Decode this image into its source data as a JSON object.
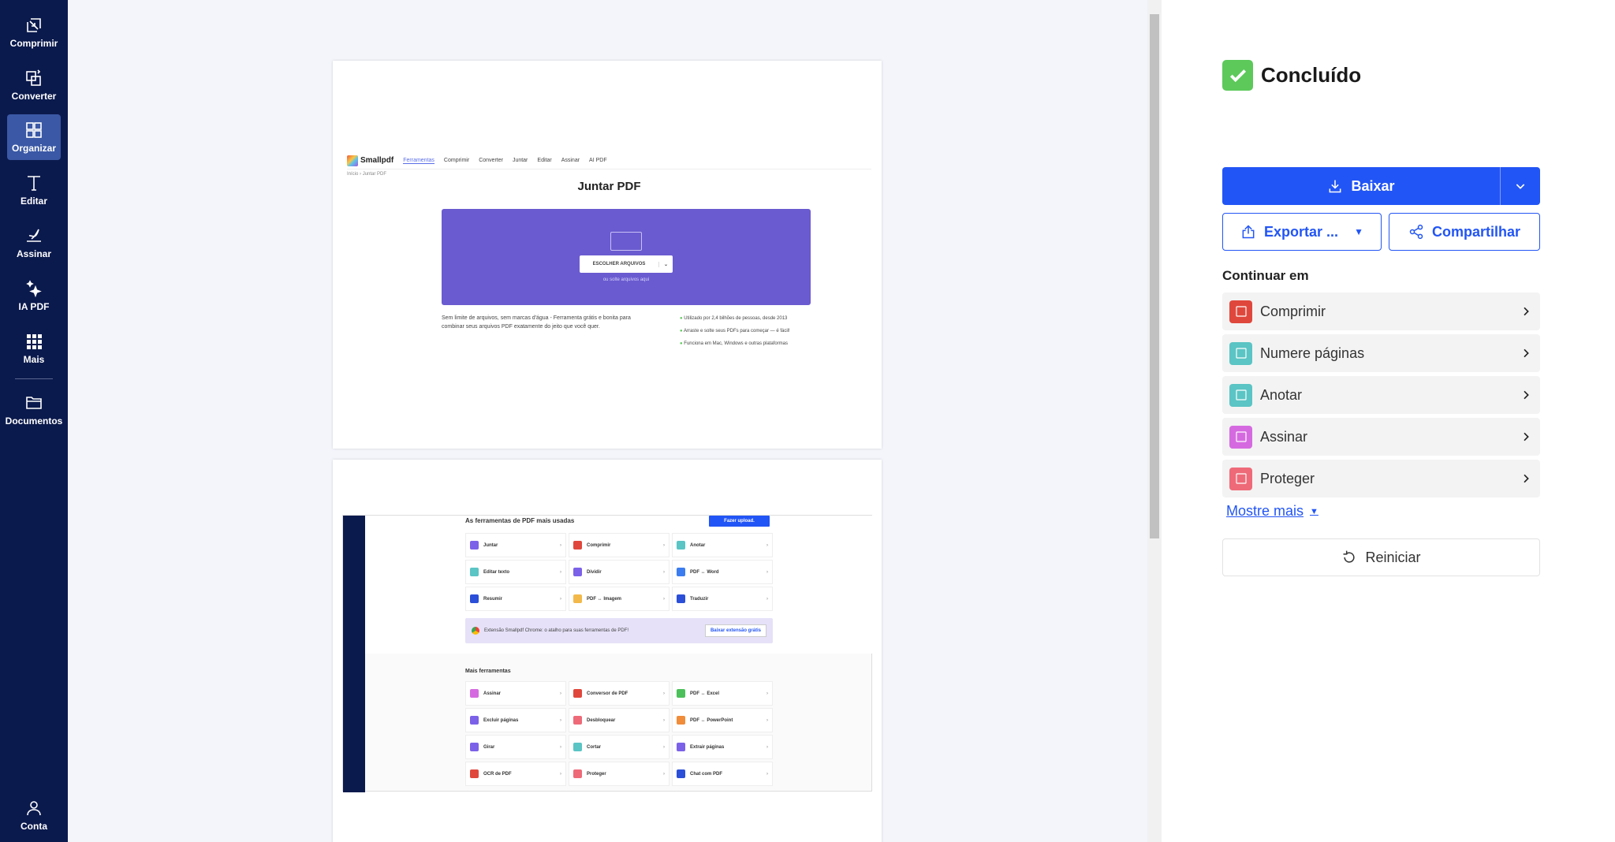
{
  "sidebar": {
    "items": [
      {
        "label": "Comprimir",
        "icon": "compress-icon"
      },
      {
        "label": "Converter",
        "icon": "convert-icon"
      },
      {
        "label": "Organizar",
        "icon": "grid-icon",
        "active": true
      },
      {
        "label": "Editar",
        "icon": "text-icon"
      },
      {
        "label": "Assinar",
        "icon": "signature-icon"
      },
      {
        "label": "IA PDF",
        "icon": "sparkles-icon"
      },
      {
        "label": "Mais",
        "icon": "apps-icon"
      }
    ],
    "documents": "Documentos",
    "account": "Conta"
  },
  "preview": {
    "page1": {
      "logo": "Smallpdf",
      "nav": [
        "Ferramentas",
        "Comprimir",
        "Converter",
        "Juntar",
        "Editar",
        "Assinar",
        "AI PDF"
      ],
      "breadcrumb": [
        "Início",
        "Juntar PDF"
      ],
      "title": "Juntar PDF",
      "choose": "ESCOLHER ARQUIVOS",
      "drop": "ou solte arquivos aqui",
      "desc": "Sem limite de arquivos, sem marcas d'água - Ferramenta grátis e bonita para combinar seus arquivos PDF exatamente do jeito que você quer.",
      "bullets": [
        "Utilizado por 2,4 bilhões de pessoas, desde 2013",
        "Arraste e solte seus PDFs para começar — é fácil!",
        "Funciona em Mac, Windows e outras plataformas"
      ]
    },
    "page2": {
      "heading": "As ferramentas de PDF mais usadas",
      "upload": "Fazer upload.",
      "tools": [
        {
          "l": "Juntar",
          "c": "#7b61e8"
        },
        {
          "l": "Comprimir",
          "c": "#e0473c"
        },
        {
          "l": "Anotar",
          "c": "#5bc4c4"
        },
        {
          "l": "Editar texto",
          "c": "#5bc4c4"
        },
        {
          "l": "Dividir",
          "c": "#7b61e8"
        },
        {
          "l": "PDF ↔ Word",
          "c": "#3b7cf0"
        },
        {
          "l": "Resumir",
          "c": "#2b4fd8"
        },
        {
          "l": "PDF ↔ Imagem",
          "c": "#f2b94a"
        },
        {
          "l": "Traduzir",
          "c": "#2b4fd8"
        }
      ],
      "ext_text": "Extensão Smallpdf Chrome: o atalho para suas ferramentas de PDF!",
      "ext_btn": "Baixar extensão grátis",
      "more_heading": "Mais ferramentas",
      "more_tools": [
        {
          "l": "Assinar",
          "c": "#d56ae0"
        },
        {
          "l": "Conversor de PDF",
          "c": "#e0473c"
        },
        {
          "l": "PDF ↔ Excel",
          "c": "#4cc05a"
        },
        {
          "l": "Excluir páginas",
          "c": "#7b61e8"
        },
        {
          "l": "Desbloquear",
          "c": "#ee6a78"
        },
        {
          "l": "PDF ↔ PowerPoint",
          "c": "#f08c3a"
        },
        {
          "l": "Girar",
          "c": "#7b61e8"
        },
        {
          "l": "Cortar",
          "c": "#5bc4c4"
        },
        {
          "l": "Extrair páginas",
          "c": "#7b61e8"
        },
        {
          "l": "OCR de PDF",
          "c": "#e0473c"
        },
        {
          "l": "Proteger",
          "c": "#ee6a78"
        },
        {
          "l": "Chat com PDF",
          "c": "#2b4fd8"
        }
      ]
    }
  },
  "panel": {
    "status": "Concluído",
    "download": "Baixar",
    "export": "Exportar ...",
    "share": "Compartilhar",
    "continue_heading": "Continuar em",
    "tools": [
      {
        "label": "Comprimir",
        "color": "#e0473c",
        "icon": "compress-icon"
      },
      {
        "label": "Numere páginas",
        "color": "#5bc4c4",
        "icon": "page-numbers-icon"
      },
      {
        "label": "Anotar",
        "color": "#5bc4c4",
        "icon": "pencil-icon"
      },
      {
        "label": "Assinar",
        "color": "#d56ae0",
        "icon": "signature-icon"
      },
      {
        "label": "Proteger",
        "color": "#ee6a78",
        "icon": "lock-icon"
      }
    ],
    "show_more": "Mostre mais",
    "restart": "Reiniciar"
  }
}
